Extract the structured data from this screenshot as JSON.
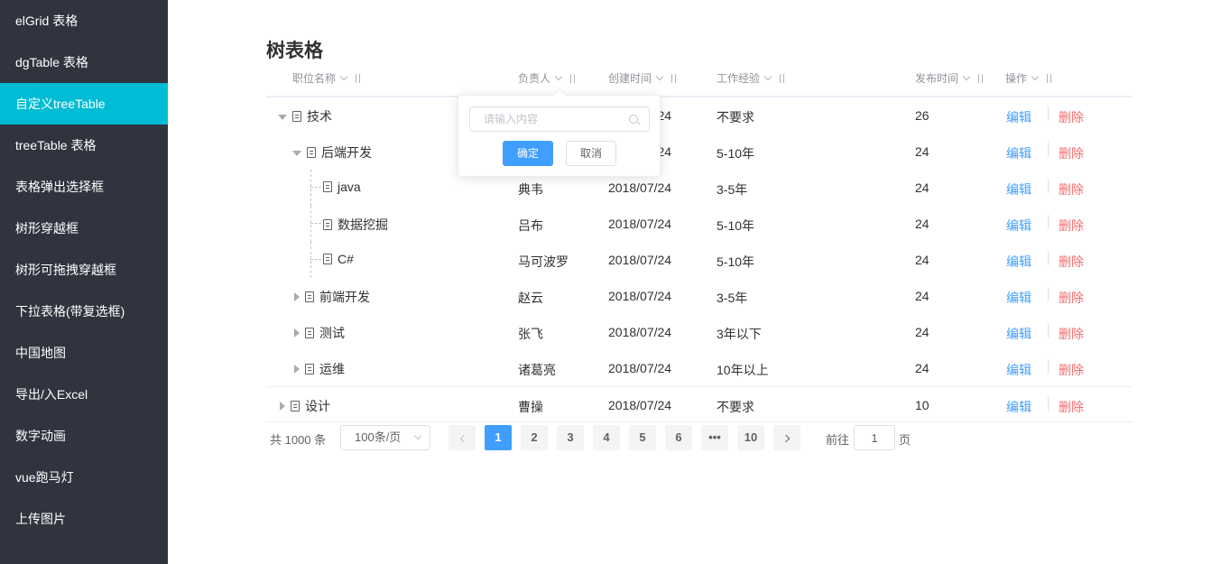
{
  "sidebar": {
    "items": [
      {
        "label": "elGrid 表格",
        "active": false
      },
      {
        "label": "dgTable 表格",
        "active": false
      },
      {
        "label": "自定义treeTable",
        "active": true
      },
      {
        "label": "treeTable 表格",
        "active": false
      },
      {
        "label": "表格弹出选择框",
        "active": false
      },
      {
        "label": "树形穿越框",
        "active": false
      },
      {
        "label": "树形可拖拽穿越框",
        "active": false
      },
      {
        "label": "下拉表格(带复选框)",
        "active": false
      },
      {
        "label": "中国地图",
        "active": false
      },
      {
        "label": "导出/入Excel",
        "active": false
      },
      {
        "label": "数字动画",
        "active": false
      },
      {
        "label": "vue跑马灯",
        "active": false
      },
      {
        "label": "上传图片",
        "active": false
      }
    ]
  },
  "page": {
    "title": "树表格"
  },
  "table": {
    "headers": {
      "name": "职位名称",
      "owner": "负责人",
      "created": "创建时间",
      "experience": "工作经验",
      "published": "发布时间",
      "actions": "操作"
    },
    "edit_label": "编辑",
    "delete_label": "删除",
    "rows": [
      {
        "name": "技术",
        "owner": "",
        "created": "2018/07/24",
        "experience": "不要求",
        "published": "26",
        "level": 0,
        "caret": "down"
      },
      {
        "name": "后端开发",
        "owner": "",
        "created": "2018/07/24",
        "experience": "5-10年",
        "published": "24",
        "level": 1,
        "caret": "down"
      },
      {
        "name": "java",
        "owner": "典韦",
        "created": "2018/07/24",
        "experience": "3-5年",
        "published": "24",
        "level": 2,
        "caret": "none"
      },
      {
        "name": "数据挖掘",
        "owner": "吕布",
        "created": "2018/07/24",
        "experience": "5-10年",
        "published": "24",
        "level": 2,
        "caret": "none"
      },
      {
        "name": "C#",
        "owner": "马可波罗",
        "created": "2018/07/24",
        "experience": "5-10年",
        "published": "24",
        "level": 2,
        "caret": "none"
      },
      {
        "name": "前端开发",
        "owner": "赵云",
        "created": "2018/07/24",
        "experience": "3-5年",
        "published": "24",
        "level": 1,
        "caret": "right"
      },
      {
        "name": "测试",
        "owner": "张飞",
        "created": "2018/07/24",
        "experience": "3年以下",
        "published": "24",
        "level": 1,
        "caret": "right"
      },
      {
        "name": "运维",
        "owner": "诸葛亮",
        "created": "2018/07/24",
        "experience": "10年以上",
        "published": "24",
        "level": 1,
        "caret": "right"
      },
      {
        "name": "设计",
        "owner": "曹操",
        "created": "2018/07/24",
        "experience": "不要求",
        "published": "10",
        "level": 0,
        "caret": "right"
      }
    ]
  },
  "filter_popover": {
    "placeholder": "请输入内容",
    "confirm_label": "确定",
    "cancel_label": "取消"
  },
  "pagination": {
    "total_text": "共 1000 条",
    "page_size": "100条/页",
    "pages": [
      "1",
      "2",
      "3",
      "4",
      "5",
      "6",
      "•••",
      "10"
    ],
    "current_page": "1",
    "goto_label": "前往",
    "goto_value": "1",
    "page_suffix": "页"
  },
  "colors": {
    "sidebar_bg": "#30343f",
    "sidebar_active": "#00bcd4",
    "primary": "#409eff",
    "danger": "#f56c6c"
  }
}
